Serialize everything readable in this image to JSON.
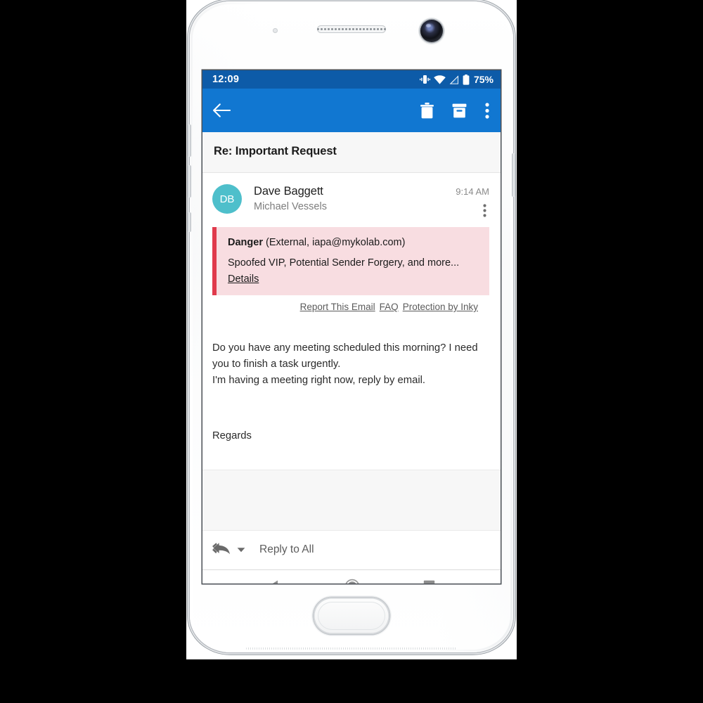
{
  "device": {
    "frame_color": "#ffffff",
    "camera": "front-camera",
    "speaker": "earpiece-speaker",
    "home_button": "home-button"
  },
  "status_bar": {
    "time": "12:09",
    "battery_percent": "75%",
    "icons": [
      "vibrate-icon",
      "wifi-icon",
      "cellular-signal-icon",
      "battery-icon"
    ],
    "background": "#0d5ba8"
  },
  "app_bar": {
    "background": "#1177d1",
    "back": "back-arrow-icon",
    "actions": [
      {
        "name": "delete-icon",
        "label": "Delete"
      },
      {
        "name": "archive-icon",
        "label": "Archive"
      },
      {
        "name": "overflow-menu-icon",
        "label": "More options"
      }
    ]
  },
  "email": {
    "subject": "Re: Important Request",
    "sender": {
      "initials": "DB",
      "name": "Dave Baggett",
      "avatar_color": "#4ebfcb"
    },
    "recipient": "Michael Vessels",
    "timestamp": "9:14 AM",
    "body_paragraphs": [
      "Do you have any meeting scheduled this morning? I need you to finish a task urgently.",
      "I'm having a meeting right now, reply by email."
    ],
    "signoff": "Regards"
  },
  "warning_banner": {
    "severity": "Danger",
    "source": "(External, iapa@mykolab.com)",
    "summary": "Spoofed VIP, Potential Sender Forgery, and more...",
    "details_link": "Details",
    "accent_color": "#e03a4c",
    "background_color": "#f8dde1",
    "footer_links": [
      "Report This Email",
      "FAQ",
      "Protection by Inky"
    ]
  },
  "reply_bar": {
    "icon": "reply-all-icon",
    "caret": "dropdown-caret-icon",
    "label": "Reply to All"
  },
  "nav_bar": {
    "buttons": [
      {
        "name": "android-back-button",
        "label": "Back"
      },
      {
        "name": "android-home-button",
        "label": "Home"
      },
      {
        "name": "android-recents-button",
        "label": "Recents"
      }
    ]
  }
}
